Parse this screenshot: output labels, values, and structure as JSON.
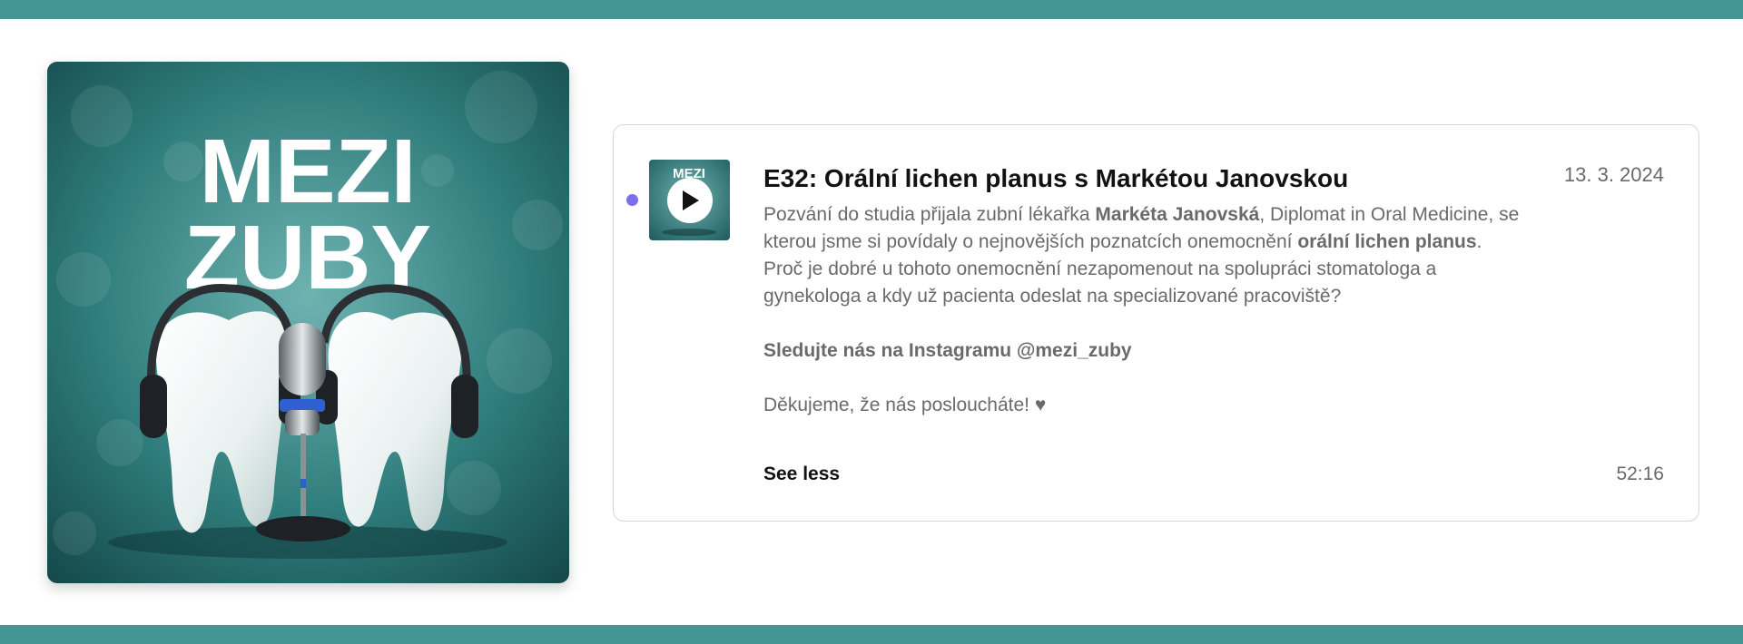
{
  "podcast": {
    "cover_title_line1": "MEZI",
    "cover_title_line2": "ZUBY",
    "accent_color": "#449593"
  },
  "episode": {
    "thumb_label": "MEZI",
    "title": "E32: Orální lichen planus s Markétou Janovskou",
    "date": "13. 3. 2024",
    "desc_p1_a": "Pozvání do studia přijala zubní lékařka ",
    "desc_p1_b": "Markéta Janovská",
    "desc_p1_c": ", Diplomat in Oral Medicine, se kterou jsme si povídaly o nejnovějších poznatcích onemocnění ",
    "desc_p1_d": "orální lichen planus",
    "desc_p1_e": ". Proč je dobré u tohoto onemocnění nezapomenout na spolupráci stomatologa a gynekologa a kdy už pacienta odeslat na specializované pracoviště?",
    "desc_p2": "Sledujte nás na Instagramu @mezi_zuby",
    "desc_p3": "Děkujeme, že nás posloucháte! ♥",
    "see_less_label": "See less",
    "duration": "52:16",
    "unplayed_dot_color": "#7b6ff0"
  }
}
